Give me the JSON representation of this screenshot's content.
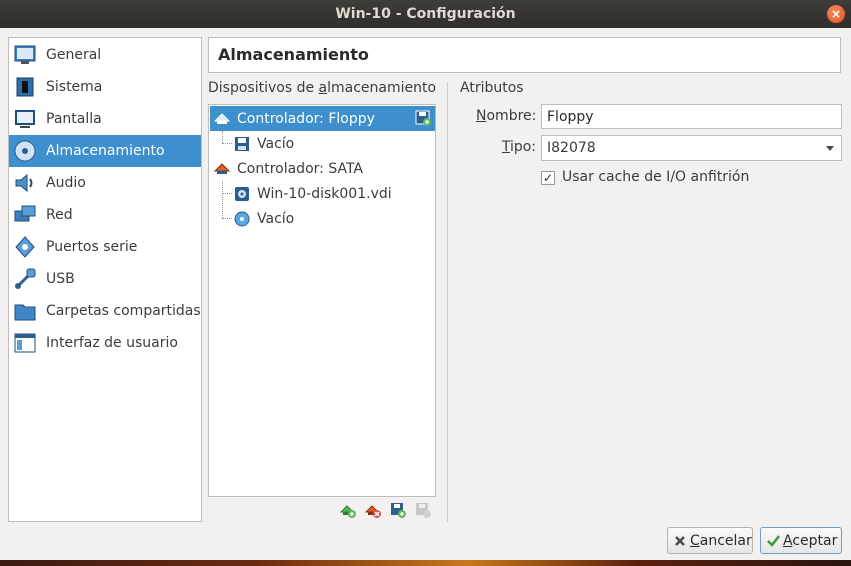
{
  "window": {
    "title": "Win-10 - Configuración",
    "close_glyph": "×"
  },
  "sidebar": {
    "items": [
      {
        "label": "General",
        "icon": "general-icon"
      },
      {
        "label": "Sistema",
        "icon": "system-chip-icon"
      },
      {
        "label": "Pantalla",
        "icon": "display-icon"
      },
      {
        "label": "Almacenamiento",
        "icon": "storage-icon",
        "selected": true
      },
      {
        "label": "Audio",
        "icon": "speaker-icon"
      },
      {
        "label": "Red",
        "icon": "network-icon"
      },
      {
        "label": "Puertos serie",
        "icon": "serial-port-icon"
      },
      {
        "label": "USB",
        "icon": "usb-icon"
      },
      {
        "label": "Carpetas compartidas",
        "icon": "folder-icon"
      },
      {
        "label": "Interfaz de usuario",
        "icon": "ui-icon"
      }
    ]
  },
  "page": {
    "title": "Almacenamiento"
  },
  "devices": {
    "label_pre": "Dispositivos de ",
    "label_mnemonic": "a",
    "label_post": "lmacenamiento",
    "tree": [
      {
        "text": "Controlador: Floppy",
        "icon": "floppy-controller-icon",
        "level": 0,
        "selected": true
      },
      {
        "text": "Vacío",
        "icon": "floppy-disk-icon",
        "level": 1
      },
      {
        "text": "Controlador: SATA",
        "icon": "sata-controller-icon",
        "level": 0
      },
      {
        "text": "Win-10-disk001.vdi",
        "icon": "hard-disk-icon",
        "level": 1
      },
      {
        "text": "Vacío",
        "icon": "optical-disk-icon",
        "level": 1
      }
    ]
  },
  "attributes": {
    "label": "Atributos",
    "name_label_mnemonic": "N",
    "name_label_rest": "ombre:",
    "name_value": "Floppy",
    "type_label_mnemonic": "T",
    "type_label_rest": "ipo:",
    "type_value": "I82078",
    "cache_label": "Usar cache de I/O anfitrión",
    "cache_checked": "✓"
  },
  "buttons": {
    "cancel_mnemonic": "C",
    "cancel_rest": "ancelar",
    "accept_mnemonic": "A",
    "accept_rest": "ceptar"
  },
  "colors": {
    "selection": "#3d8fce",
    "titlebar": "#3e3d39"
  }
}
